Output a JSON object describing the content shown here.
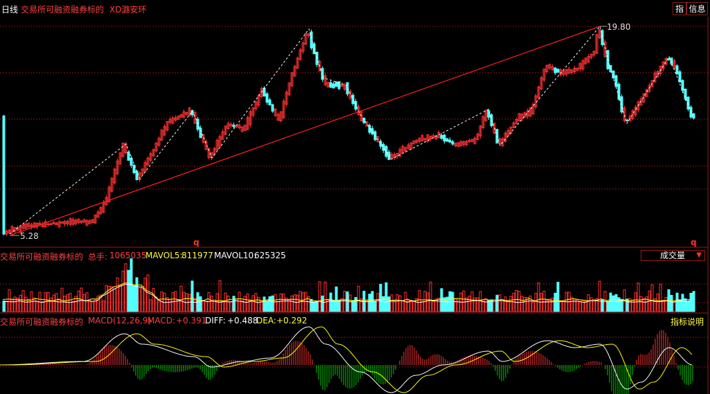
{
  "header": {
    "period": "日线",
    "title": "交易所可融资融券标的",
    "xd": "XD潞安环",
    "btn_indicator": "指",
    "btn_info": "信息"
  },
  "price_panel": {
    "high_label": "19.80",
    "low_label": "5.28",
    "q_marker_1": "q",
    "q_marker_2": "q"
  },
  "volume_panel": {
    "title": "交易所可融资融券标的",
    "total_label": "总手:",
    "total_value": "1065035",
    "mavol5_label": "MAVOL5:",
    "mavol5_value": "811977",
    "mavol10_label": "MAVOL10:",
    "mavol10_value": "625325",
    "selector": "成交量"
  },
  "macd_panel": {
    "title": "交易所可融资融券标的",
    "params": "MACD(12,26,9)",
    "macd_label": "MACD:",
    "macd_value": "+0.391",
    "diff_label": "DIFF:",
    "diff_value": "+0.488",
    "dea_label": "DEA:",
    "dea_value": "+0.292",
    "explain": "指标说明"
  },
  "colors": {
    "up": "#ff3232",
    "down": "#54ffff",
    "grid": "#8a1515",
    "yellow": "#ffff00",
    "white": "#ffffff",
    "macd_pos": "#ff3232",
    "macd_neg": "#00cc00"
  }
}
